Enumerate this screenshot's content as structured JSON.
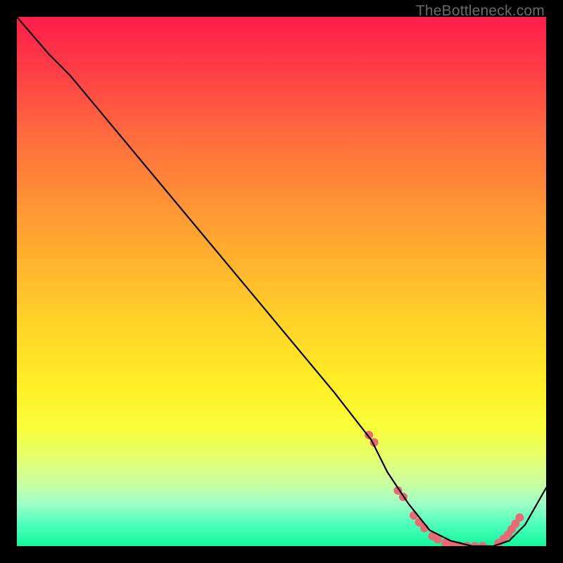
{
  "watermark": "TheBottleneck.com",
  "chart_data": {
    "type": "line",
    "title": "",
    "xlabel": "",
    "ylabel": "",
    "xlim": [
      0,
      100
    ],
    "ylim": [
      0,
      100
    ],
    "series": [
      {
        "name": "curve",
        "x": [
          0,
          6,
          10,
          20,
          30,
          40,
          50,
          60,
          67,
          70,
          74,
          78,
          82,
          86,
          90,
          93,
          96,
          100
        ],
        "y": [
          100,
          93,
          89,
          77,
          65,
          53,
          41,
          29,
          20,
          14,
          8,
          3,
          1,
          0,
          0,
          1,
          4,
          11
        ],
        "stroke": "#000000",
        "stroke_width": 2.2
      }
    ],
    "markers": {
      "name": "dots",
      "x": [
        66.5,
        67.5,
        72,
        73,
        75,
        76,
        77,
        78.5,
        79.5,
        81,
        82,
        83.5,
        85,
        86.5,
        88,
        91,
        92,
        92.8,
        93.5,
        94.2,
        95
      ],
      "y": [
        21,
        19.6,
        10.5,
        9.3,
        5.8,
        4.5,
        3.4,
        1.9,
        1.3,
        0.6,
        0.3,
        0.1,
        0,
        0,
        0,
        0.6,
        1.4,
        2.2,
        3.2,
        4.2,
        5.4
      ],
      "color": "#e86a74",
      "radius": 6
    }
  }
}
